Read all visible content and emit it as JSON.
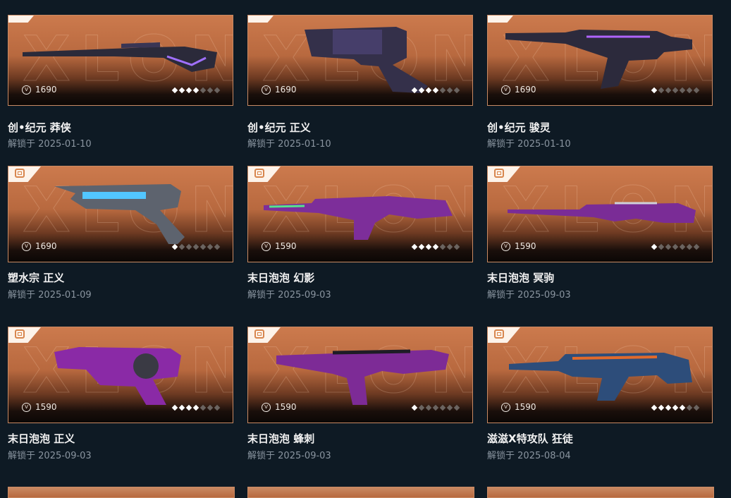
{
  "unlock_prefix": "解锁于",
  "cards": [
    {
      "name": "创•纪元 莽侠",
      "price": "1690",
      "date": "2025-01-10",
      "level": 4,
      "accent": "#7a4cff"
    },
    {
      "name": "创•纪元 正义",
      "price": "1690",
      "date": "2025-01-10",
      "level": 4,
      "accent": "#7a4cff"
    },
    {
      "name": "创•纪元 骏灵",
      "price": "1690",
      "date": "2025-01-10",
      "level": 1,
      "accent": "#7a4cff"
    },
    {
      "name": "塑水宗 正义",
      "price": "1690",
      "date": "2025-01-09",
      "level": 1,
      "accent": "#3fc0ff"
    },
    {
      "name": "末日泡泡 幻影",
      "price": "1590",
      "date": "2025-09-03",
      "level": 4,
      "accent": "#c23ed6"
    },
    {
      "name": "末日泡泡 冥驹",
      "price": "1590",
      "date": "2025-09-03",
      "level": 1,
      "accent": "#c23ed6"
    },
    {
      "name": "末日泡泡 正义",
      "price": "1590",
      "date": "2025-09-03",
      "level": 4,
      "accent": "#c23ed6"
    },
    {
      "name": "末日泡泡 蜂刺",
      "price": "1590",
      "date": "2025-09-03",
      "level": 1,
      "accent": "#c23ed6"
    },
    {
      "name": "滋滋X特攻队 狂徒",
      "price": "1590",
      "date": "2025-08-04",
      "level": 5,
      "accent": "#3a6ea8"
    }
  ]
}
